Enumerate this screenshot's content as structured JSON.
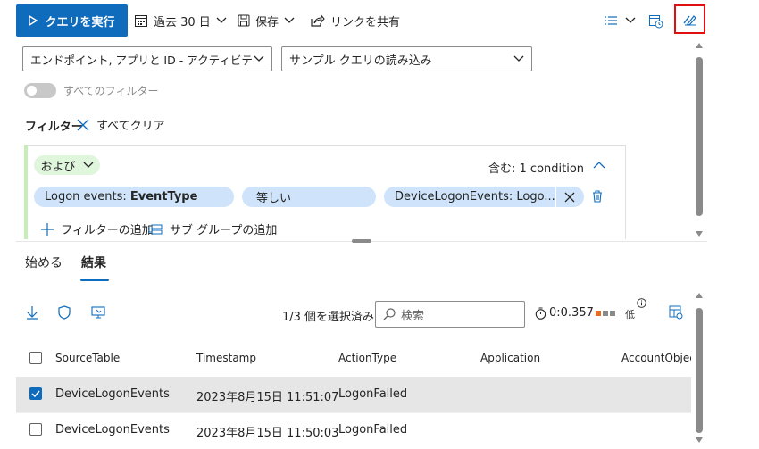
{
  "toolbar": {
    "run_query": "クエリを実行",
    "time_range": "過去 30 日",
    "save": "保存",
    "share_link": "リンクを共有"
  },
  "query_builder": {
    "schema_dropdown": "エンドポイント, アプリと ID - アクティビティ ログ,...",
    "sample_dropdown": "サンプル クエリの読み込み",
    "all_filters_toggle": "すべてのフィルター",
    "filter_label": "フィルター",
    "clear_all": "すべてクリア",
    "group": {
      "operator": "および",
      "contains_label": "含む: 1 condition",
      "condition": {
        "field_prefix": "Logon events: ",
        "field_name": "EventType",
        "operator": "等しい",
        "value": "DeviceLogonEvents: Logo..."
      }
    },
    "add_filter": "フィルターの追加",
    "add_subgroup": "サブ グループの追加"
  },
  "results_tabs": {
    "tabs": [
      "始める",
      "結果"
    ],
    "active": "結果"
  },
  "results": {
    "selection": "1/3 個を選択済み",
    "search_placeholder": "検索",
    "elapsed": "0:0.357",
    "resource_level": "低",
    "columns": [
      "SourceTable",
      "Timestamp",
      "ActionType",
      "Application",
      "AccountObjectI"
    ],
    "rows": [
      {
        "checked": true,
        "SourceTable": "DeviceLogonEvents",
        "Timestamp": "2023年8月15日 11:51:07",
        "ActionType": "LogonFailed"
      },
      {
        "checked": false,
        "SourceTable": "DeviceLogonEvents",
        "Timestamp": "2023年8月15日 11:50:03",
        "ActionType": "LogonFailed"
      }
    ]
  },
  "colors": {
    "accent": "#0f6cbd",
    "and_group": "#dff6dd",
    "condition_pill": "#cfe4fa",
    "highlight": "#e01010",
    "selected_row": "#e6e6e6"
  },
  "icons": [
    "play-icon",
    "calendar-icon",
    "chevron-down-icon",
    "save-icon",
    "share-icon",
    "list-view-icon",
    "schedule-icon",
    "edit-query-icon",
    "close-icon",
    "chevron-up-icon",
    "delete-icon",
    "add-icon",
    "subgroup-icon",
    "download-icon",
    "shield-icon",
    "device-action-icon",
    "search-icon",
    "timer-icon",
    "info-icon",
    "column-settings-icon",
    "checkmark-icon"
  ]
}
